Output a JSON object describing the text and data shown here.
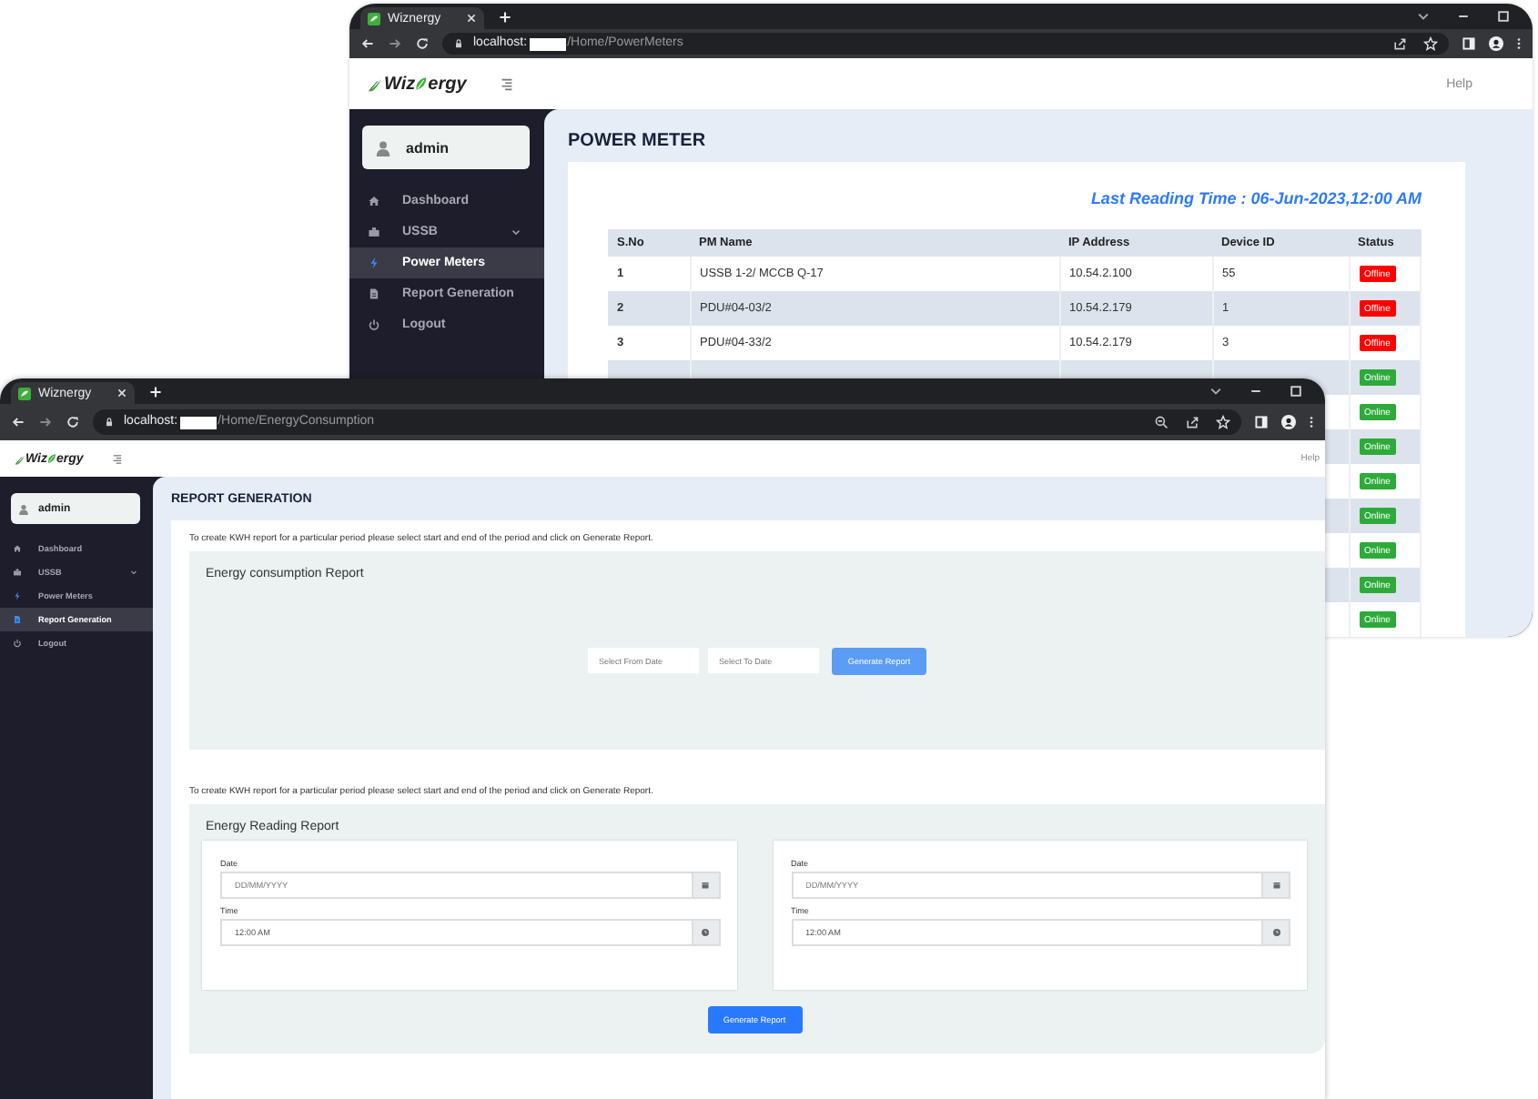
{
  "windows": [
    {
      "kind": "power_meter",
      "tab": {
        "title": "Wiznergy"
      },
      "address": {
        "host": "localhost:",
        "path": "/Home/PowerMeters"
      },
      "header": {
        "logo": {
          "lead": "Wiz",
          "tail": "ergy"
        },
        "help": "Help"
      },
      "sidebar": {
        "user": "admin",
        "items": [
          {
            "label": "Dashboard",
            "selected": false,
            "kind": "link"
          },
          {
            "label": "USSB",
            "selected": false,
            "kind": "group"
          },
          {
            "label": "Power Meters",
            "selected": true,
            "kind": "link"
          },
          {
            "label": "Report Generation",
            "selected": false,
            "kind": "link"
          },
          {
            "label": "Logout",
            "selected": false,
            "kind": "link"
          }
        ]
      },
      "page": {
        "title": "POWER METER",
        "last_reading": "Last Reading Time : 06-Jun-2023,12:00 AM",
        "table": {
          "columns": [
            "S.No",
            "PM Name",
            "IP Address",
            "Device ID",
            "Status"
          ],
          "rows": [
            {
              "sno": "1",
              "pm_name": "USSB 1-2/ MCCB Q-17",
              "ip": "10.54.2.100",
              "device_id": "55",
              "status": "Offline",
              "color": "#ff0000"
            },
            {
              "sno": "2",
              "pm_name": "PDU#04-03/2",
              "ip": "10.54.2.179",
              "device_id": "1",
              "status": "Offline",
              "color": "#ff0000"
            },
            {
              "sno": "3",
              "pm_name": "PDU#04-33/2",
              "ip": "10.54.2.179",
              "device_id": "3",
              "status": "Offline",
              "color": "#ff0000"
            },
            {
              "status": "Online",
              "color": "#2eaa3a"
            },
            {
              "status": "Online",
              "color": "#2eaa3a"
            },
            {
              "status": "Online",
              "color": "#2eaa3a"
            },
            {
              "status": "Online",
              "color": "#2eaa3a"
            },
            {
              "status": "Online",
              "color": "#2eaa3a"
            },
            {
              "status": "Online",
              "color": "#2eaa3a"
            },
            {
              "status": "Online",
              "color": "#2eaa3a"
            },
            {
              "status": "Online",
              "color": "#2eaa3a"
            }
          ]
        }
      }
    },
    {
      "kind": "report",
      "tab": {
        "title": "Wiznergy"
      },
      "address": {
        "host": "localhost:",
        "path": "/Home/EnergyConsumption"
      },
      "header": {
        "logo": {
          "lead": "Wiz",
          "tail": "ergy"
        },
        "help": "Help"
      },
      "sidebar": {
        "user": "admin",
        "items": [
          {
            "label": "Dashboard",
            "selected": false,
            "kind": "link"
          },
          {
            "label": "USSB",
            "selected": false,
            "kind": "group"
          },
          {
            "label": "Power Meters",
            "selected": false,
            "kind": "link"
          },
          {
            "label": "Report Generation",
            "selected": true,
            "kind": "link"
          },
          {
            "label": "Logout",
            "selected": false,
            "kind": "link"
          }
        ]
      },
      "page": {
        "title": "REPORT GENERATION",
        "sections": [
          {
            "kind": "consumption",
            "intro": "To create KWH report for a particular period please select start and end of the period and click on Generate Report.",
            "title": "Energy consumption Report",
            "from": {
              "placeholder": "Select From Date"
            },
            "to": {
              "placeholder": "Select To Date"
            },
            "button": "Generate Report"
          },
          {
            "kind": "reading",
            "intro": "To create KWH report for a particular period please select start and end of the period and click on Generate Report.",
            "title": "Energy Reading Report",
            "cards": [
              {
                "date_label": "Date",
                "date": {
                  "placeholder": "DD/MM/YYYY"
                },
                "time_label": "Time",
                "time": {
                  "value": "12:00 AM"
                }
              },
              {
                "date_label": "Date",
                "date": {
                  "placeholder": "DD/MM/YYYY"
                },
                "time_label": "Time",
                "time": {
                  "value": "12:00 AM"
                }
              }
            ],
            "button": "Generate Report"
          }
        ]
      }
    }
  ]
}
